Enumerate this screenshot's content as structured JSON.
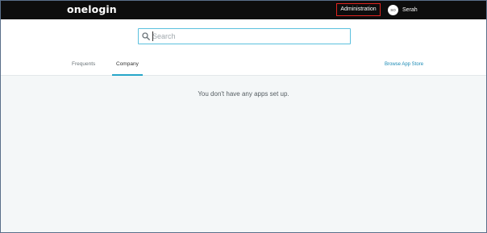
{
  "topbar": {
    "logo_text": "onelogin",
    "admin_label": "Administration",
    "avatar_initials": "SO",
    "user_name": "Serah"
  },
  "search": {
    "placeholder": "Search",
    "value": ""
  },
  "tabs": [
    {
      "label": "Frequents",
      "active": false
    },
    {
      "label": "Company",
      "active": true
    }
  ],
  "browse_app_store_label": "Browse App Store",
  "empty_message": "You don't have any apps set up.",
  "colors": {
    "topbar_bg": "#0d0d0d",
    "highlight_border": "#e0231f",
    "accent": "#27a6c9",
    "link": "#1a8ab5",
    "content_bg": "#f4f7f8"
  }
}
